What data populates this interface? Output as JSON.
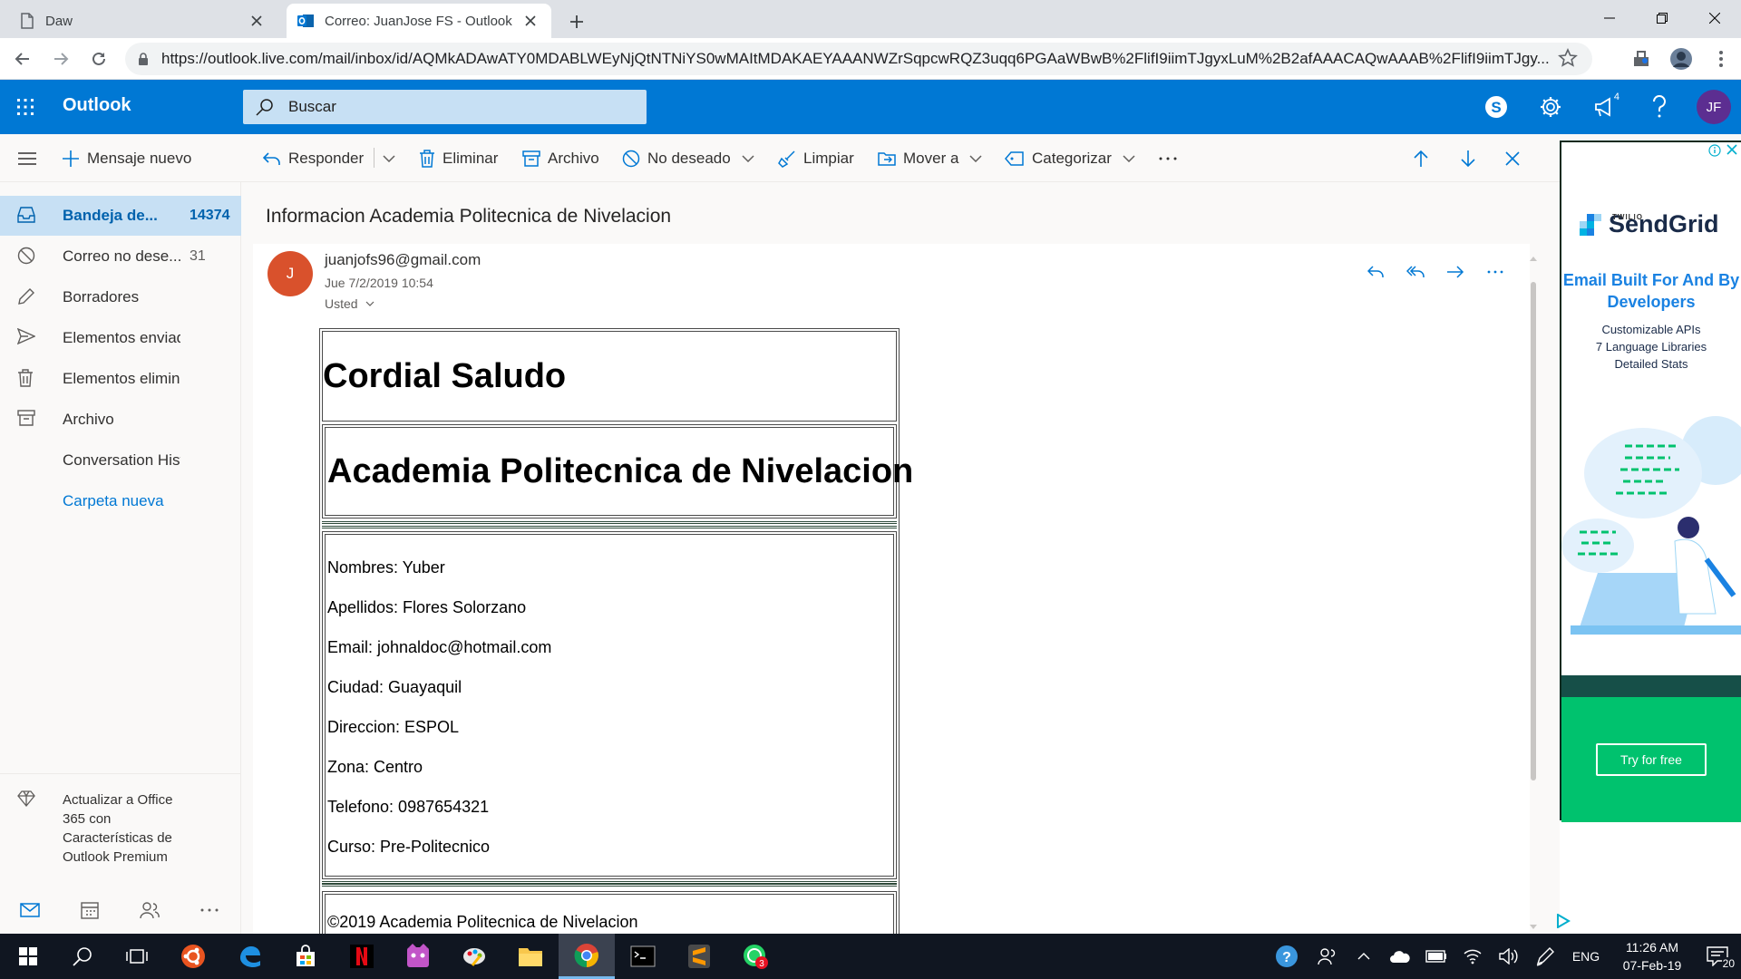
{
  "browser": {
    "tabs": [
      {
        "title": "Daw",
        "active": false
      },
      {
        "title": "Correo: JuanJose FS - Outlook",
        "active": true
      }
    ],
    "url": "https://outlook.live.com/mail/inbox/id/AQMkADAwATY0MDABLWEyNjQtNTNiYS0wMAItMDAKAEYAAANWZrSqpcwRQZ3uqq6PGAaWBwB%2FlifI9iimTJgyxLuM%2B2afAAACAQwAAAB%2FlifI9iimTJgy...",
    "ext_badge": ""
  },
  "header": {
    "brand": "Outlook",
    "search_placeholder": "Buscar",
    "notification_count": "4",
    "user_initials": "JF",
    "brand_color": "#0078d4"
  },
  "commands": {
    "new_message": "Mensaje nuevo",
    "reply": "Responder",
    "delete": "Eliminar",
    "archive": "Archivo",
    "junk": "No deseado",
    "sweep": "Limpiar",
    "move": "Mover a",
    "categorize": "Categorizar"
  },
  "folders": [
    {
      "label": "Bandeja de...",
      "count": "14374",
      "icon": "inbox-icon",
      "selected": true
    },
    {
      "label": "Correo no dese...",
      "count": "31",
      "icon": "junk-icon"
    },
    {
      "label": "Borradores",
      "count": "",
      "icon": "pencil-icon"
    },
    {
      "label": "Elementos enviados",
      "count": "",
      "icon": "send-icon"
    },
    {
      "label": "Elementos elimina...",
      "count": "",
      "icon": "trash-icon"
    },
    {
      "label": "Archivo",
      "count": "",
      "icon": "archive-icon"
    },
    {
      "label": "Conversation Hist...",
      "count": ""
    },
    {
      "label": "Carpeta nueva",
      "count": ""
    }
  ],
  "upgrade": {
    "text": "Actualizar a Office 365 con Características de Outlook Premium"
  },
  "message": {
    "subject": "Informacion Academia Politecnica de Nivelacion",
    "avatar_initial": "J",
    "sender": "juanjofs96@gmail.com",
    "date": "Jue 7/2/2019 10:54",
    "to": "Usted"
  },
  "email_body": {
    "greeting": "Cordial Saludo",
    "heading": "Academia Politecnica de Nivelacion",
    "fields": [
      "Nombres: Yuber",
      "Apellidos: Flores Solorzano",
      "Email: johnaldoc@hotmail.com",
      "Ciudad: Guayaquil",
      "Direccion: ESPOL",
      "Zona: Centro",
      "Telefono: 0987654321",
      "Curso: Pre-Politecnico"
    ],
    "footer": "©2019 Academia Politecnica de Nivelacion"
  },
  "ad": {
    "twilio": "TWILIO",
    "brand": "SendGrid",
    "headline": "Email Built For And By Developers",
    "features": [
      "Customizable APIs",
      "7 Language Libraries",
      "Detailed Stats"
    ],
    "cta": "Try for free"
  },
  "taskbar": {
    "language": "ENG",
    "time": "11:26 AM",
    "date": "07-Feb-19",
    "notification_count": "20",
    "app_badge": "3"
  }
}
